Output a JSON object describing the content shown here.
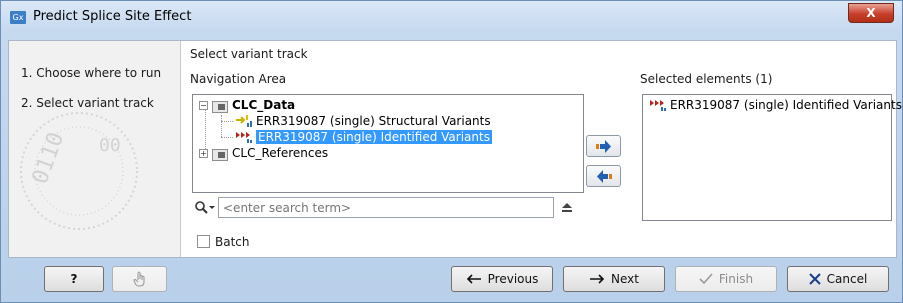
{
  "window": {
    "icon_text": "Gx",
    "title": "Predict Splice Site Effect",
    "close_glyph": "X"
  },
  "steps": [
    {
      "label": "1.  Choose where to run"
    },
    {
      "label": "2.  Select variant track"
    }
  ],
  "panel": {
    "section_title": "Select variant track",
    "navigation_label": "Navigation Area",
    "selected_label": "Selected elements (1)"
  },
  "tree": {
    "root": "CLC_Data",
    "child1": "ERR319087 (single) Structural Variants",
    "child2": "ERR319087 (single) Identified Variants",
    "root2": "CLC_References"
  },
  "search": {
    "placeholder": "<enter search term>",
    "icon": "search-icon"
  },
  "selected_items": [
    "ERR319087 (single) Identified Variants"
  ],
  "batch_label": "Batch",
  "footer": {
    "help": "?",
    "previous": "Previous",
    "next": "Next",
    "finish": "Finish",
    "cancel": "Cancel"
  },
  "colors": {
    "accent": "#3399ff",
    "frame": "#b9d0ea",
    "close": "#c7402b"
  }
}
